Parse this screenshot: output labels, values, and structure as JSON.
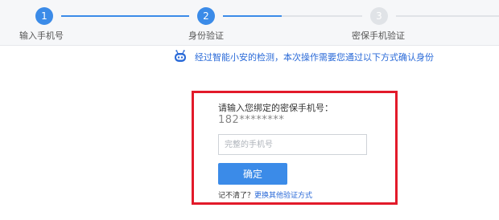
{
  "stepper": {
    "steps": [
      {
        "number": "1",
        "label": "输入手机号",
        "state": "done"
      },
      {
        "number": "2",
        "label": "身份验证",
        "state": "current"
      },
      {
        "number": "3",
        "label": "密保手机验证",
        "state": "pending"
      }
    ],
    "colors": {
      "active": "#3b8be8",
      "inactive": "#e0e3e7"
    }
  },
  "notice": {
    "icon": "robot-icon",
    "text": "经过智能小安的检测，本次操作需要您通过以下方式确认身份",
    "color": "#2a6ad8"
  },
  "verify": {
    "prompt": "请输入您绑定的密保手机号：",
    "masked_phone": "182********",
    "input": {
      "value": "",
      "placeholder": "完整的手机号"
    },
    "confirm_label": "确定",
    "forgot_text": "记不清了？",
    "alt_method_link": "更换其他验证方式",
    "highlight_color": "#e21a2a"
  }
}
